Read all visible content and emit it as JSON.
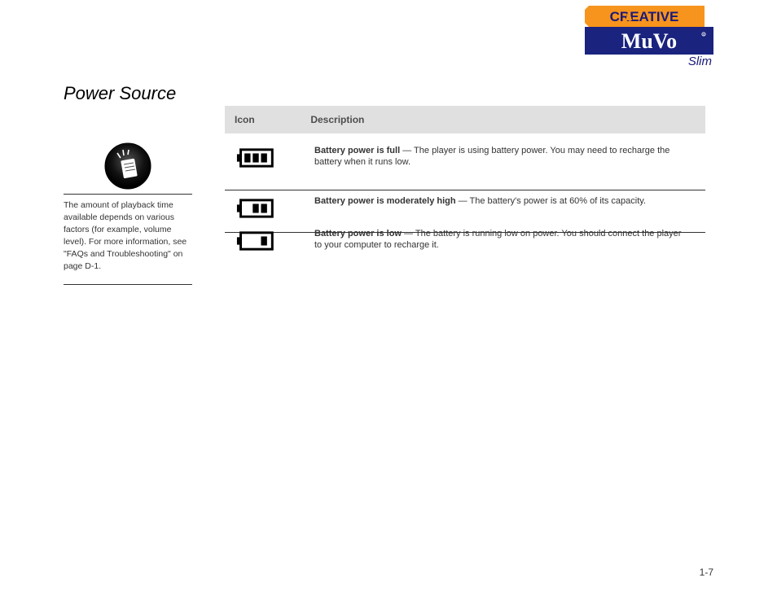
{
  "logo": {
    "brand_top": "CREATIVE",
    "brand_mid": "MuVo",
    "brand_sub": "Slim"
  },
  "heading": "Power Source",
  "table_header": {
    "col1": "Icon",
    "col2": "Description"
  },
  "rows": [
    {
      "title": "Battery power is full",
      "body": " — The player is using battery power. You may need to recharge the battery when it runs low."
    },
    {
      "title": "Battery power is moderately high",
      "body": " — The battery's power is at 60% of its capacity."
    },
    {
      "title": "Battery power is low",
      "body": " — The battery is running low on power. You should connect the player to your computer to recharge it."
    }
  ],
  "tip": {
    "line1": "The amount of playback time available depends on various factors (for example, volume level). For more information, see \"FAQs and Troubleshooting\" on page D-1.",
    "icon_alt": "tip-icon"
  },
  "page_number": "1-7"
}
